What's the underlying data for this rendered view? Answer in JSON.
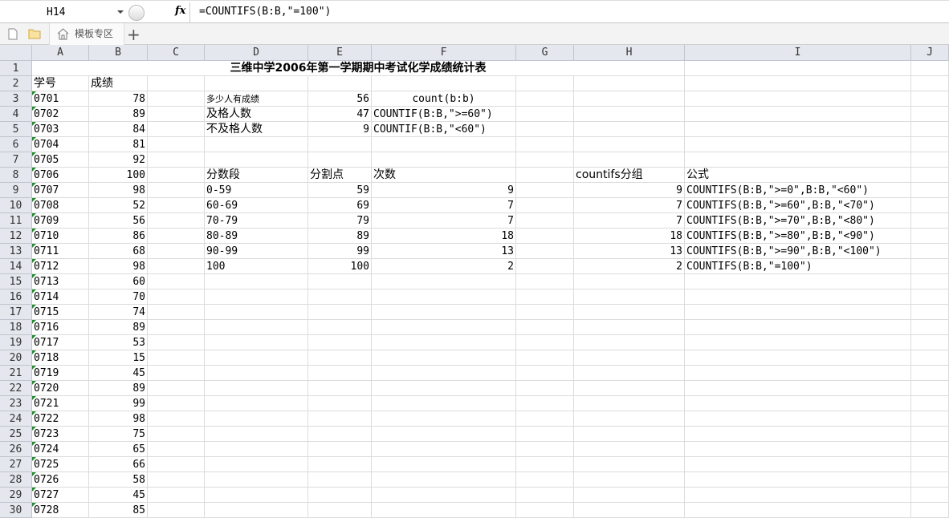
{
  "formula_bar": {
    "name_box": "H14",
    "fx": "fx",
    "formula": "=COUNTIFS(B:B,\"=100\")"
  },
  "tabs": {
    "template_tab": "模板专区",
    "add": "+"
  },
  "columns": [
    "A",
    "B",
    "C",
    "D",
    "E",
    "F",
    "G",
    "H",
    "I",
    "J"
  ],
  "title": "三维中学2006年第一学期期中考试化学成绩统计表",
  "headers": {
    "id": "学号",
    "score": "成绩"
  },
  "students": [
    [
      "0701",
      "78"
    ],
    [
      "0702",
      "89"
    ],
    [
      "0703",
      "84"
    ],
    [
      "0704",
      "81"
    ],
    [
      "0705",
      "92"
    ],
    [
      "0706",
      "100"
    ],
    [
      "0707",
      "98"
    ],
    [
      "0708",
      "52"
    ],
    [
      "0709",
      "56"
    ],
    [
      "0710",
      "86"
    ],
    [
      "0711",
      "68"
    ],
    [
      "0712",
      "98"
    ],
    [
      "0713",
      "60"
    ],
    [
      "0714",
      "70"
    ],
    [
      "0715",
      "74"
    ],
    [
      "0716",
      "89"
    ],
    [
      "0717",
      "53"
    ],
    [
      "0718",
      "15"
    ],
    [
      "0719",
      "45"
    ],
    [
      "0720",
      "89"
    ],
    [
      "0721",
      "99"
    ],
    [
      "0722",
      "98"
    ],
    [
      "0723",
      "75"
    ],
    [
      "0724",
      "65"
    ],
    [
      "0725",
      "66"
    ],
    [
      "0726",
      "58"
    ],
    [
      "0727",
      "45"
    ],
    [
      "0728",
      "85"
    ]
  ],
  "summary": [
    {
      "label": "多少人有成绩",
      "value": "56",
      "formula": "count(b:b)"
    },
    {
      "label": "及格人数",
      "value": "47",
      "formula": "COUNTIF(B:B,\">=60\")"
    },
    {
      "label": "不及格人数",
      "value": "9",
      "formula": "COUNTIF(B:B,\"<60\")"
    }
  ],
  "dist_headers": {
    "range": "分数段",
    "split": "分割点",
    "count": "次数",
    "countifs": "countifs分组",
    "formula": "公式"
  },
  "dist": [
    {
      "range": "0-59",
      "split": "59",
      "count": "9",
      "countifs": "9",
      "formula": "COUNTIFS(B:B,\">=0\",B:B,\"<60\")"
    },
    {
      "range": "60-69",
      "split": "69",
      "count": "7",
      "countifs": "7",
      "formula": "COUNTIFS(B:B,\">=60\",B:B,\"<70\")"
    },
    {
      "range": "70-79",
      "split": "79",
      "count": "7",
      "countifs": "7",
      "formula": "COUNTIFS(B:B,\">=70\",B:B,\"<80\")"
    },
    {
      "range": "80-89",
      "split": "89",
      "count": "18",
      "countifs": "18",
      "formula": "COUNTIFS(B:B,\">=80\",B:B,\"<90\")"
    },
    {
      "range": "90-99",
      "split": "99",
      "count": "13",
      "countifs": "13",
      "formula": "COUNTIFS(B:B,\">=90\",B:B,\"<100\")"
    },
    {
      "range": "100",
      "split": "100",
      "count": "2",
      "countifs": "2",
      "formula": "COUNTIFS(B:B,\"=100\")"
    }
  ]
}
